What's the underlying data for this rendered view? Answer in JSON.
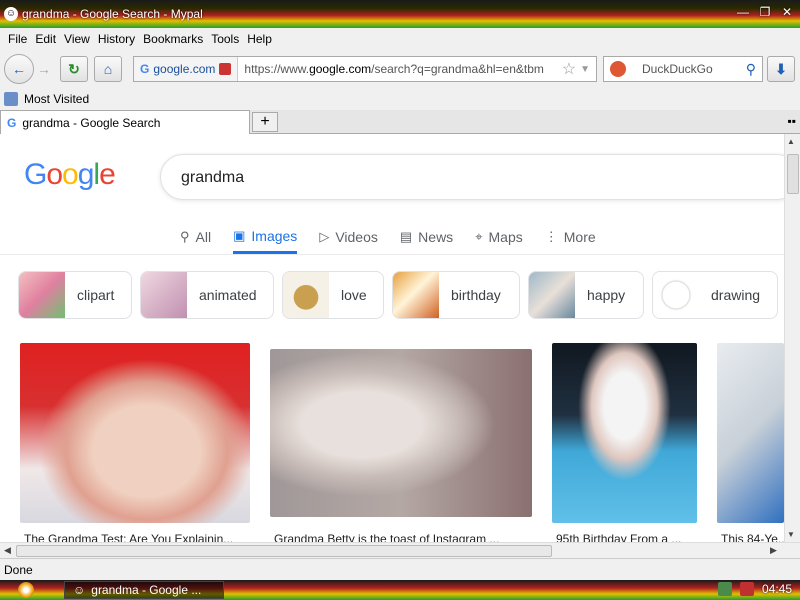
{
  "window": {
    "title": "grandma - Google Search - Mypal"
  },
  "menu": [
    "File",
    "Edit",
    "View",
    "History",
    "Bookmarks",
    "Tools",
    "Help"
  ],
  "nav": {
    "identity": "google.com",
    "url_prefix": "https://www.",
    "url_host": "google.com",
    "url_rest": "/search?q=grandma&hl=en&tbm",
    "search_placeholder": "DuckDuckGo"
  },
  "bookmarks": {
    "most_visited": "Most Visited"
  },
  "tab": {
    "title": "grandma - Google Search",
    "new_tab": "+"
  },
  "google": {
    "logo": [
      "G",
      "o",
      "o",
      "g",
      "l",
      "e"
    ],
    "query": "grandma",
    "tabs": [
      {
        "label": "All",
        "icon": "search-icon"
      },
      {
        "label": "Images",
        "icon": "image-icon",
        "active": true
      },
      {
        "label": "Videos",
        "icon": "play-icon"
      },
      {
        "label": "News",
        "icon": "news-icon"
      },
      {
        "label": "Maps",
        "icon": "map-pin-icon"
      },
      {
        "label": "More",
        "icon": "more-vert-icon"
      }
    ],
    "chips": [
      "clipart",
      "animated",
      "love",
      "birthday",
      "happy",
      "drawing"
    ],
    "results": [
      {
        "caption": "The Grandma Test: Are You Explainin..."
      },
      {
        "caption": "Grandma Betty is the toast of Instagram ..."
      },
      {
        "caption": "95th Birthday From a ..."
      },
      {
        "caption": "This 84-Ye..."
      }
    ]
  },
  "status": {
    "text": "Done"
  },
  "taskbar": {
    "task": "grandma - Google ...",
    "clock": "04:45"
  },
  "colors": {
    "google_blue": "#4285f4",
    "google_red": "#ea4335",
    "google_yellow": "#fbbc05",
    "google_green": "#34a853",
    "active_tab": "#1a73e8"
  }
}
